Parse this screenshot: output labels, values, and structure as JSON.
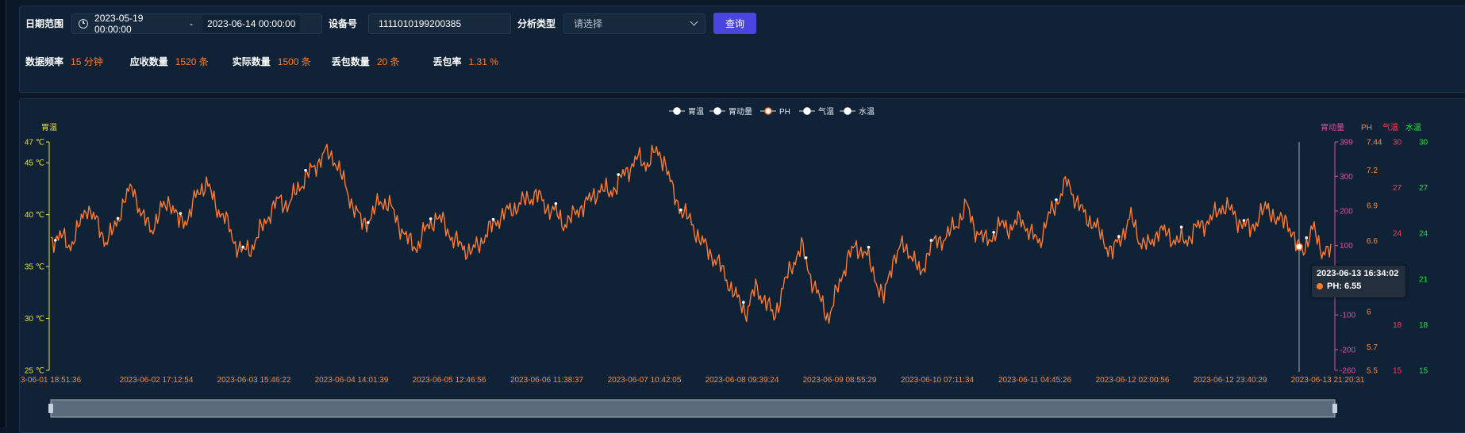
{
  "filters": {
    "date_range_label": "日期范围",
    "start_date": "2023-05-19 00:00:00",
    "date_separator": "-",
    "end_date": "2023-06-14 00:00:00",
    "device_label": "设备号",
    "device_value": "1111010199200385",
    "analysis_label": "分析类型",
    "analysis_placeholder": "请选择",
    "query_button": "查询"
  },
  "stats": [
    {
      "label": "数据频率",
      "value": "15 分钟"
    },
    {
      "label": "应收数量",
      "value": "1520 条"
    },
    {
      "label": "实际数量",
      "value": "1500 条"
    },
    {
      "label": "丢包数量",
      "value": "20 条"
    },
    {
      "label": "丢包率",
      "value": "1.31 %"
    }
  ],
  "colors": {
    "accent": "#4a44e0",
    "value": "#ff7a2a",
    "stomach_temp_axis": "#e8e04a",
    "motility_axis": "#e0509c",
    "ph_axis": "#ff8a3a",
    "air_temp_axis": "#ff3b5a",
    "water_temp_axis": "#21e046"
  },
  "tooltip": {
    "time": "2023-06-13 16:34:02",
    "series": "PH",
    "value_text": "PH: 6.55"
  },
  "chart_data": {
    "type": "line",
    "legend": [
      "胃温",
      "胃动量",
      "PH",
      "气温",
      "水温"
    ],
    "legend_position": "top-center",
    "x_tick_labels": [
      "3-06-01 18:51:36",
      "2023-06-02 17:12:54",
      "2023-06-03 15:46:22",
      "2023-06-04 14:01:39",
      "2023-06-05 12:46:56",
      "2023-06-06 11:38:37",
      "2023-06-07 10:42:05",
      "2023-06-08 09:39:24",
      "2023-06-09 08:55:29",
      "2023-06-10 07:11:34",
      "2023-06-11 04:45:26",
      "2023-06-12 02:00:56",
      "2023-06-12 23:40:29",
      "2023-06-13 21:20:31"
    ],
    "y_axes": [
      {
        "name": "胃温",
        "side": "left",
        "ticks": [
          "25 ℃",
          "30 ℃",
          "35 ℃",
          "40 ℃",
          "45 ℃",
          "47 ℃"
        ],
        "range": [
          25,
          47
        ]
      },
      {
        "name": "胃动量",
        "side": "right",
        "ticks": [
          "-260",
          "-200",
          "-100",
          "100",
          "200",
          "300",
          "399"
        ],
        "range": [
          -260,
          399
        ]
      },
      {
        "name": "PH",
        "side": "right",
        "ticks": [
          "5.5",
          "5.7",
          "6",
          "6.6",
          "6.9",
          "7.2",
          "7.44"
        ],
        "range": [
          5.5,
          7.44
        ]
      },
      {
        "name": "气温",
        "side": "right",
        "ticks": [
          "15",
          "18",
          "24",
          "27",
          "30"
        ],
        "range": [
          15,
          30
        ]
      },
      {
        "name": "水温",
        "side": "right",
        "ticks": [
          "15",
          "18",
          "21",
          "24",
          "27",
          "30"
        ],
        "range": [
          15,
          30
        ]
      }
    ],
    "series": [
      {
        "name": "PH",
        "color": "#ff7a2a",
        "values": [
          6.6,
          6.65,
          6.55,
          6.7,
          6.9,
          6.75,
          6.6,
          6.7,
          6.95,
          7.05,
          6.8,
          6.7,
          6.85,
          6.95,
          6.75,
          6.8,
          7.0,
          7.1,
          6.9,
          6.8,
          6.6,
          6.5,
          6.55,
          6.7,
          6.85,
          6.95,
          6.9,
          7.05,
          7.15,
          7.25,
          7.35,
          7.3,
          7.1,
          6.9,
          6.75,
          6.8,
          6.95,
          6.9,
          6.75,
          6.6,
          6.55,
          6.7,
          6.8,
          6.75,
          6.6,
          6.55,
          6.5,
          6.6,
          6.7,
          6.8,
          6.85,
          6.9,
          6.95,
          7.0,
          6.9,
          6.85,
          6.75,
          6.8,
          6.9,
          6.95,
          7.05,
          7.0,
          7.1,
          7.2,
          7.3,
          7.25,
          7.35,
          7.3,
          7.0,
          6.85,
          6.75,
          6.6,
          6.5,
          6.4,
          6.25,
          6.1,
          6.0,
          6.2,
          6.1,
          5.95,
          6.2,
          6.4,
          6.55,
          6.3,
          6.1,
          5.95,
          6.2,
          6.45,
          6.55,
          6.5,
          6.3,
          6.1,
          6.45,
          6.55,
          6.5,
          6.3,
          6.55,
          6.6,
          6.65,
          6.75,
          6.9,
          6.7,
          6.6,
          6.65,
          6.75,
          6.7,
          6.8,
          6.65,
          6.6,
          6.8,
          6.95,
          7.1,
          6.95,
          6.8,
          6.75,
          6.6,
          6.5,
          6.65,
          6.8,
          6.6,
          6.55,
          6.7,
          6.65,
          6.6,
          6.6,
          6.7,
          6.75,
          6.8,
          6.9,
          6.85,
          6.75,
          6.7,
          6.8,
          6.9,
          6.75,
          6.8,
          6.55,
          6.55,
          6.7,
          6.5
        ]
      }
    ],
    "ph_ylim": [
      5.5,
      7.44
    ],
    "stomach_temp_ylim": [
      25,
      47
    ],
    "grid": false,
    "data_zoom": {
      "start": 0,
      "end": 100
    }
  }
}
